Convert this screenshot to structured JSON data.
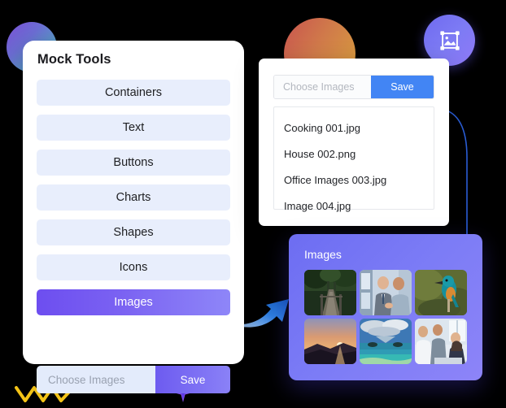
{
  "tools_panel": {
    "title": "Mock Tools",
    "items": [
      {
        "label": "Containers",
        "active": false
      },
      {
        "label": "Text",
        "active": false
      },
      {
        "label": "Buttons",
        "active": false
      },
      {
        "label": "Charts",
        "active": false
      },
      {
        "label": "Shapes",
        "active": false
      },
      {
        "label": "Icons",
        "active": false
      },
      {
        "label": "Images",
        "active": true
      }
    ],
    "upload": {
      "placeholder": "Choose Images",
      "save_label": "Save"
    }
  },
  "file_panel": {
    "upload": {
      "placeholder": "Choose Images",
      "save_label": "Save"
    },
    "files": [
      "Cooking 001.jpg",
      "House 002.png",
      "Office Images 003.jpg",
      "Image 004.jpg"
    ]
  },
  "gallery_panel": {
    "title": "Images",
    "thumbnails": [
      "forest-boardwalk-photo",
      "businessmen-handshake-photo",
      "kingfisher-bird-photo",
      "sunset-hills-photo",
      "seascape-islands-photo",
      "office-meeting-photo"
    ]
  },
  "decorations": {
    "badge_icon": "image-frame-icon",
    "arrow": "curved-arrow-icon",
    "zigzag": "zigzag-line-icon",
    "cross": "cross-marker-icon",
    "curve": "curved-line-icon"
  },
  "colors": {
    "accent_purple": "#6d4ef0",
    "accent_blue": "#4285f4",
    "tool_item_bg": "#e8eefc",
    "panel_white": "#ffffff",
    "background": "#000000"
  }
}
